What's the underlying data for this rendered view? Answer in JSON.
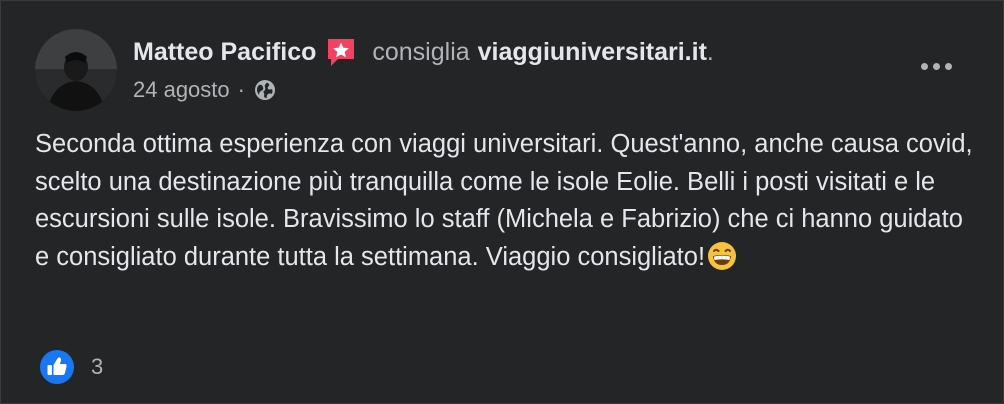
{
  "post": {
    "author": "Matteo Pacifico",
    "verb": "consiglia",
    "page": "viaggiuniversitari.it",
    "page_suffix": ".",
    "date": "24 agosto",
    "separator": "·",
    "text": "Seconda ottima esperienza con viaggi universitari. Quest'anno, anche causa covid, scelto una destinazione più tranquilla come le isole Eolie. Belli i posti visitati e le escursioni sulle isole. Bravissimo lo staff (Michela e Fabrizio) che ci hanno guidato e consigliato durante tutta la settimana. Viaggio consigliato!",
    "reactions_count": "3"
  },
  "icons": {
    "recommend": "recommend-star-icon",
    "audience": "globe-icon",
    "emoji": "grinning-face-emoji",
    "reaction": "like-icon",
    "more": "more-options-icon"
  },
  "colors": {
    "background": "#242526",
    "primary_text": "#e4e6eb",
    "secondary_text": "#b0b3b8",
    "recommend_badge": "#f3425f",
    "like_blue": "#1877f2"
  }
}
